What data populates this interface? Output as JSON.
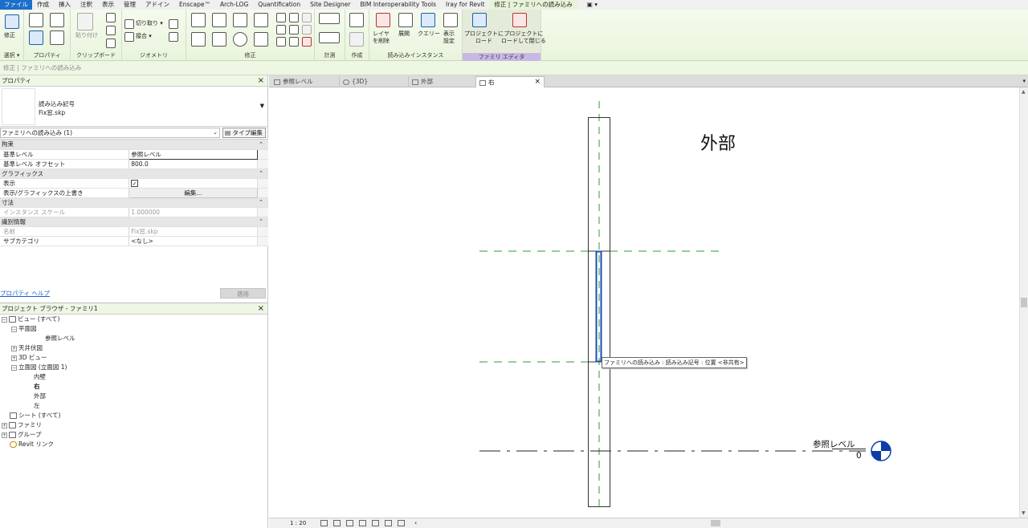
{
  "ribbon_tabs": [
    "ファイル",
    "作成",
    "挿入",
    "注釈",
    "表示",
    "管理",
    "アドイン",
    "Enscape™",
    "Arch-LOG",
    "Quantification",
    "Site Designer",
    "BIM Interoperability Tools",
    "Iray for Revit",
    "修正 | ファミリへの読み込み"
  ],
  "qat_label": "▣ ▾",
  "ribbon": {
    "modify_label": "修正",
    "paste_label": "貼り付け",
    "cut_label": "切り取り ▾",
    "join_label": "接合 ▾",
    "layer_delete_label": "レイヤ\nを削除",
    "explode_label": "展開",
    "query_label": "クエリー",
    "display_settings_label": "表示\n設定",
    "load_project_label": "プロジェクトに\nロード",
    "load_close_label": "プロジェクトに\nロードして閉じる",
    "groups": {
      "select": "選択 ▾",
      "properties": "プロパティ",
      "clipboard": "クリップボード",
      "geometry": "ジオメトリ",
      "modify": "修正",
      "measure": "計測",
      "create": "作成",
      "import_instance": "読み込みインスタンス",
      "family_editor": "ファミリ エディタ"
    }
  },
  "options_bar": "修正 | ファミリへの読み込み",
  "properties": {
    "title": "プロパティ",
    "type_name_1": "読み込み記号",
    "type_name_2": "Fix窓.skp",
    "instance_filter": "ファミリへの読み込み (1)",
    "edit_type_label": "タイプ編集",
    "cat_constraints": "拘束",
    "base_level_label": "基準レベル",
    "base_level_value": "参照レベル",
    "base_offset_label": "基準レベル オフセット",
    "base_offset_value": "800.0",
    "cat_graphics": "グラフィックス",
    "visible_label": "表示",
    "visible_checked": "✓",
    "override_label": "表示/グラフィックスの上書き",
    "override_button": "編集...",
    "cat_dimensions": "寸法",
    "scale_label": "インスタンス スケール",
    "scale_value": "1.000000",
    "cat_identity": "識別情報",
    "name_label": "名前",
    "name_value": "Fix窓.skp",
    "subcategory_label": "サブカテゴリ",
    "subcategory_value": "<なし>",
    "help_link": "プロパティ ヘルプ",
    "apply_button": "適用"
  },
  "browser": {
    "title": "プロジェクト ブラウザ - ファミリ1",
    "views_all": "ビュー (すべて)",
    "floor_plans": "平面図",
    "ref_level": "参照レベル",
    "ceiling_plans": "天井伏図",
    "views_3d": "3D ビュー",
    "elevations": "立面図 (立面図 1)",
    "elev_interior": "内壁",
    "elev_right": "右",
    "elev_exterior": "外部",
    "elev_left": "左",
    "sheets": "シート (すべて)",
    "families": "ファミリ",
    "groups": "グループ",
    "revit_links": "Revit リンク"
  },
  "view_tabs": [
    {
      "label": "参照レベル"
    },
    {
      "label": "{3D}"
    },
    {
      "label": "外部"
    },
    {
      "label": "右"
    }
  ],
  "view_tabs_close": "×",
  "canvas": {
    "elevation_title": "外部",
    "tooltip": "ファミリへの読み込み : 読み込み記号 : 位置 <非共有>",
    "level_name": "参照レベル",
    "level_value": "0"
  },
  "status": {
    "scale": "1 : 20"
  },
  "colors": {
    "file_tab": "#1a6fc9",
    "ribbon_active": "#e8f4d9",
    "family_editor_label": "#c8b8e4",
    "ref_plane": "#2e9e2e",
    "selection": "#1a4fb0",
    "link": "#1a5fcc"
  }
}
